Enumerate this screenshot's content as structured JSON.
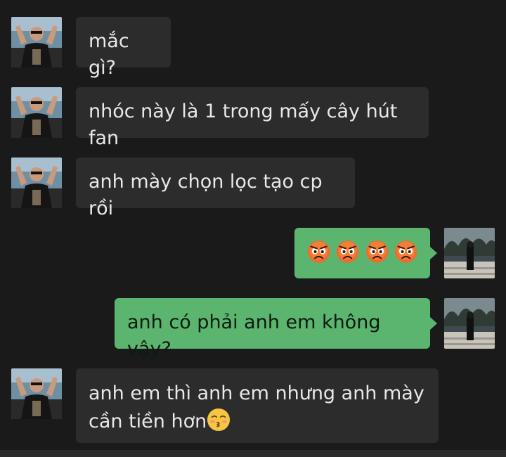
{
  "colors": {
    "background": "#1a1a1a",
    "incoming_bubble": "#2c2c2c",
    "outgoing_bubble": "#5bb56f",
    "incoming_text": "#e8e8e8",
    "outgoing_text": "#0d1a10"
  },
  "messages": [
    {
      "direction": "incoming",
      "text": "mắc gì?"
    },
    {
      "direction": "incoming",
      "text": "nhóc này là 1 trong mấy cây hút fan"
    },
    {
      "direction": "incoming",
      "text": "anh mày chọn lọc tạo cp rồi"
    },
    {
      "direction": "outgoing",
      "emoji": [
        "angry-face-icon",
        "angry-face-icon",
        "angry-face-icon",
        "angry-face-icon"
      ]
    },
    {
      "direction": "outgoing",
      "text": "anh có phải anh em không vậy?"
    },
    {
      "direction": "incoming",
      "text_line1": "anh em thì anh em nhưng anh mày",
      "text_line2": "cần tiền hơn",
      "emoji": "kissing-face-icon"
    }
  ]
}
